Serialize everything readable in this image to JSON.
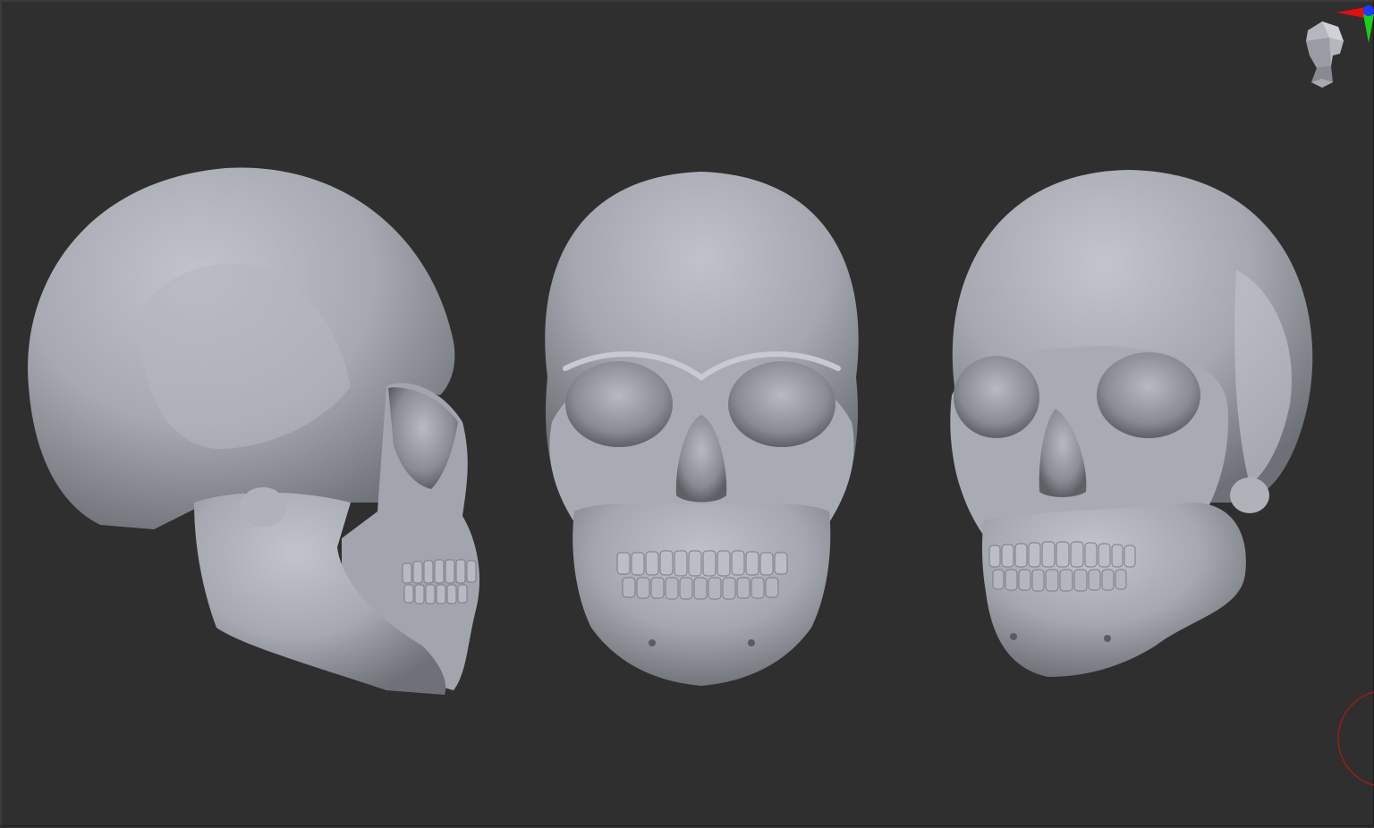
{
  "app": {
    "name": "",
    "viewport_background": "#2f2f2f"
  },
  "scene": {
    "models": [
      {
        "view": "side",
        "shade": "#a7a9b2"
      },
      {
        "view": "front",
        "shade": "#a7a9b2"
      },
      {
        "view": "three-quarter",
        "shade": "#a7a9b2"
      }
    ]
  },
  "navigation": {
    "head_icon": "head-navigation-icon",
    "axis_colors": {
      "x": "#e01010",
      "y": "#18d018",
      "z": "#1a3cff"
    }
  },
  "brush": {
    "cursor_color": "#b01818"
  }
}
